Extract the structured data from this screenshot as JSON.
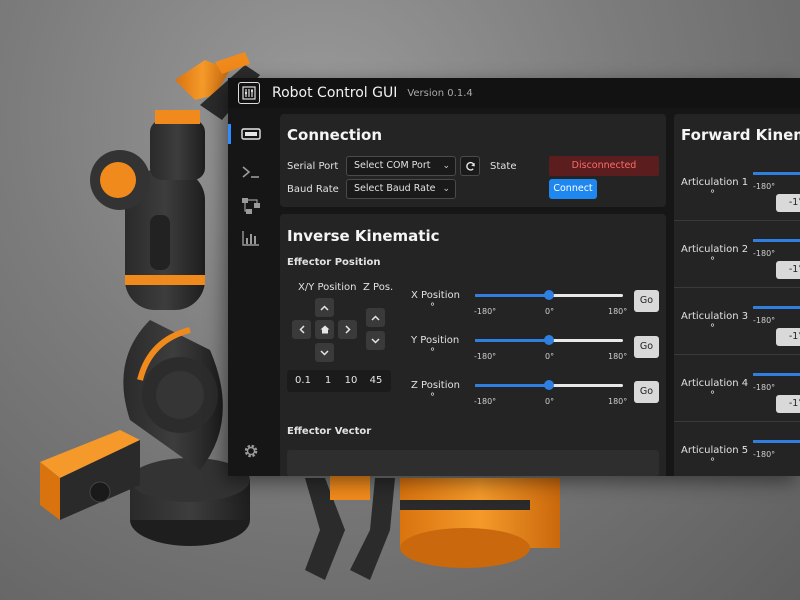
{
  "app": {
    "title": "Robot Control GUI",
    "version": "Version 0.1.4"
  },
  "sidebar": {
    "items": [
      {
        "name": "connection",
        "icon": "serial-port-icon",
        "active": true
      },
      {
        "name": "terminal",
        "icon": "terminal-icon",
        "active": false
      },
      {
        "name": "workflow",
        "icon": "diagram-icon",
        "active": false
      },
      {
        "name": "charts",
        "icon": "chart-icon",
        "active": false
      },
      {
        "name": "settings",
        "icon": "gear-icon",
        "active": false
      }
    ]
  },
  "connection": {
    "title": "Connection",
    "serial_port_label": "Serial Port",
    "serial_port_value": "Select COM Port",
    "baud_rate_label": "Baud Rate",
    "baud_rate_value": "Select Baud Rate",
    "state_label": "State",
    "state_value": "Disconnected",
    "connect_label": "Connect"
  },
  "inverse": {
    "title": "Inverse Kinematic",
    "effector_position": "Effector Position",
    "xy_label": "X/Y Position",
    "z_label": "Z Pos.",
    "steps": [
      "0.1",
      "1",
      "10",
      "45"
    ],
    "sliders": [
      {
        "label": "X Position",
        "unit": "°",
        "value": 0,
        "min": "-180°",
        "mid": "0°",
        "max": "180°",
        "go": "Go"
      },
      {
        "label": "Y Position",
        "unit": "°",
        "value": 0,
        "min": "-180°",
        "mid": "0°",
        "max": "180°",
        "go": "Go"
      },
      {
        "label": "Z Position",
        "unit": "°",
        "value": 0,
        "min": "-180°",
        "mid": "0°",
        "max": "180°",
        "go": "Go"
      }
    ],
    "effector_vector": "Effector Vector"
  },
  "forward": {
    "title": "Forward Kinema",
    "rows": [
      {
        "label": "Articulation 1",
        "unit": "°",
        "min": "-180°",
        "value": "-1°"
      },
      {
        "label": "Articulation 2",
        "unit": "°",
        "min": "-180°",
        "value": "-1°"
      },
      {
        "label": "Articulation 3",
        "unit": "°",
        "min": "-180°",
        "value": "-1°"
      },
      {
        "label": "Articulation 4",
        "unit": "°",
        "min": "-180°",
        "value": "-1°"
      },
      {
        "label": "Articulation 5",
        "unit": "°",
        "min": "-180°",
        "value": ""
      }
    ]
  },
  "colors": {
    "accent": "#1e88f0",
    "robot_orange": "#f08a1c",
    "danger_text": "#ff6b6b"
  }
}
